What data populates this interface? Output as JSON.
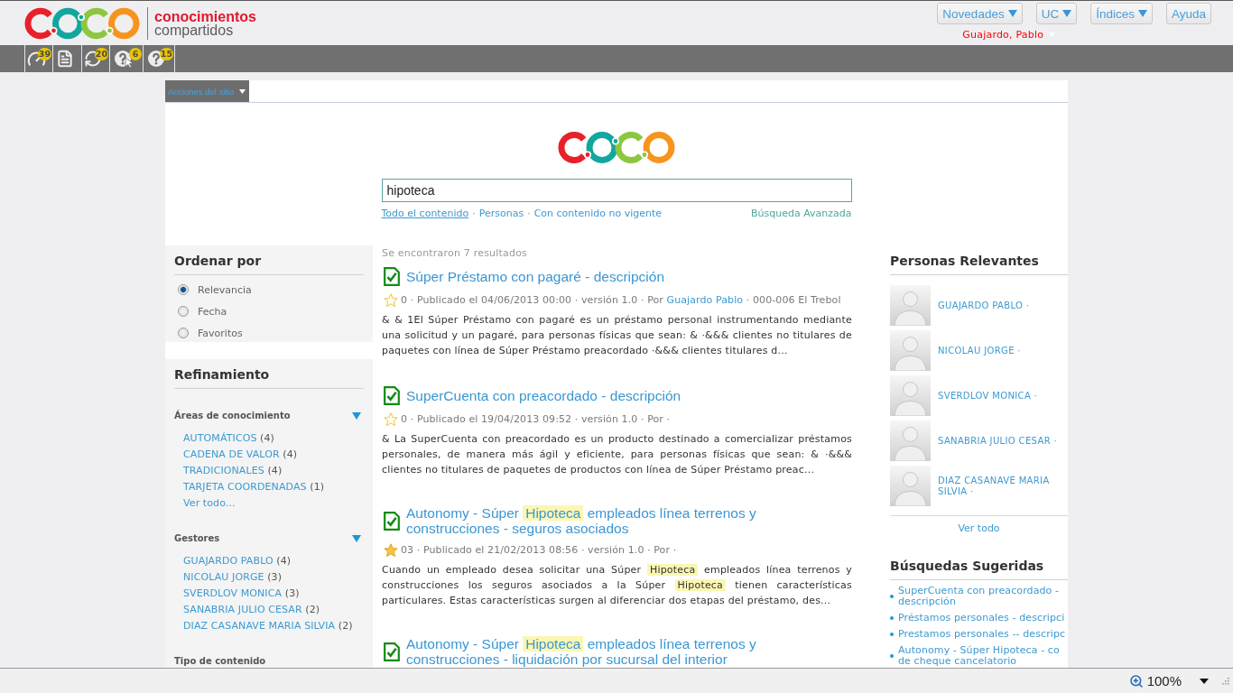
{
  "header": {
    "brand": [
      "conocimientos",
      "compartidos"
    ],
    "menu": [
      {
        "label": "Novedades",
        "dropdown": true
      },
      {
        "label": "UC",
        "dropdown": true
      },
      {
        "label": "Índices",
        "dropdown": true
      },
      {
        "label": "Ayuda",
        "dropdown": false
      }
    ],
    "user": "Guajardo, Pablo"
  },
  "toolbar": [
    {
      "kind": "gauge",
      "badge": "39"
    },
    {
      "kind": "document"
    },
    {
      "kind": "refresh",
      "badge": "20"
    },
    {
      "kind": "help-pointer",
      "badge": "6"
    },
    {
      "kind": "help",
      "badge": "15"
    }
  ],
  "site_actions": "Acciones del sitio",
  "search": {
    "value": "hipoteca",
    "scopes": [
      {
        "label": "Todo el contenido",
        "selected": true
      },
      {
        "label": "Personas",
        "selected": false,
        "separator": "·"
      },
      {
        "label": "Con contenido no vigente",
        "selected": false,
        "separator": "·"
      }
    ],
    "advanced": "Búsqueda Avanzada"
  },
  "sort": {
    "title": "Ordenar por",
    "options": [
      {
        "label": "Relevancia",
        "selected": true
      },
      {
        "label": "Fecha",
        "selected": false
      },
      {
        "label": "Favoritos",
        "selected": false
      }
    ]
  },
  "refinement": {
    "title": "Refinamiento",
    "groups": [
      {
        "title": "Áreas de conocimiento",
        "expanded": true,
        "items": [
          {
            "label": "AUTOMÁTICOS",
            "count": "(4)"
          },
          {
            "label": "CADENA DE VALOR",
            "count": "(4)"
          },
          {
            "label": "TRADICIONALES",
            "count": "(4)"
          },
          {
            "label": "TARJETA COORDENADAS",
            "count": "(1)"
          }
        ],
        "more": "Ver todo..."
      },
      {
        "title": "Gestores",
        "expanded": true,
        "items": [
          {
            "label": "GUAJARDO PABLO",
            "count": "(4)"
          },
          {
            "label": "NICOLAU JORGE",
            "count": "(3)"
          },
          {
            "label": "SVERDLOV MONICA",
            "count": "(3)"
          },
          {
            "label": "SANABRIA JULIO CESAR",
            "count": "(2)"
          },
          {
            "label": "DIAZ CASANAVE MARIA SILVIA",
            "count": "(2)"
          }
        ]
      },
      {
        "title": "Tipo de contenido"
      }
    ]
  },
  "results": {
    "summary": "Se encontraron 7 resultados",
    "items": [
      {
        "title": [
          {
            "kind": "text",
            "text": "Súper Préstamo con pagaré - descripción"
          }
        ],
        "starred": false,
        "meta": [
          {
            "kind": "text",
            "text": "0 · Publicado el 04/06/2013 00:00 · versión 1.0 · Por "
          },
          {
            "kind": "link",
            "text": "Guajardo Pablo"
          },
          {
            "kind": "text",
            "text": " · 000-006 El Trebol"
          }
        ],
        "description": [
          {
            "kind": "text",
            "text": "& & 1El Súper Préstamo con pagaré es un préstamo personal instrumentando mediante una solicitud y un pagaré, para personas físicas que sean: & ·&&& clientes no titulares de paquetes con línea de Súper Préstamo preacordado ·&&& clientes titulares d..."
          }
        ]
      },
      {
        "title": [
          {
            "kind": "text",
            "text": "SuperCuenta con preacordado - descripción"
          }
        ],
        "starred": false,
        "meta": [
          {
            "kind": "text",
            "text": "0 · Publicado el 19/04/2013 09:52 · versión 1.0 · Por ·"
          }
        ],
        "description": [
          {
            "kind": "text",
            "text": "& La SuperCuenta con preacordado es un producto destinado a comercializar préstamos personales, de manera más ágil y eficiente, para personas físicas que sean: & ·&&& clientes no titulares de paquetes de productos con línea de Súper Préstamo preac..."
          }
        ]
      },
      {
        "title": [
          {
            "kind": "text",
            "text": "Autonomy - Súper "
          },
          {
            "kind": "match",
            "text": "Hipoteca"
          },
          {
            "kind": "text",
            "text": " empleados línea terrenos y construcciones - seguros asociados"
          }
        ],
        "starred": true,
        "meta": [
          {
            "kind": "text",
            "text": "03 · Publicado el 21/02/2013 08:56 · versión 1.0 · Por ·"
          }
        ],
        "description": [
          {
            "kind": "text",
            "text": "Cuando un empleado desea solicitar una Súper "
          },
          {
            "kind": "match",
            "text": "Hipoteca"
          },
          {
            "kind": "text",
            "text": " empleados línea terrenos y construcciones los seguros asociados a la Súper "
          },
          {
            "kind": "match",
            "text": "Hipoteca"
          },
          {
            "kind": "text",
            "text": " tienen características particulares. Estas características surgen al diferenciar dos etapas del préstamo, des..."
          }
        ]
      },
      {
        "title": [
          {
            "kind": "text",
            "text": "Autonomy - Súper "
          },
          {
            "kind": "match",
            "text": "Hipoteca"
          },
          {
            "kind": "text",
            "text": " empleados línea terrenos y construcciones - liquidación por sucursal del interior"
          }
        ]
      }
    ]
  },
  "people": {
    "title": "Personas Relevantes",
    "items": [
      "GUAJARDO PABLO ·",
      "NICOLAU JORGE ·",
      "SVERDLOV MONICA ·",
      "SANABRIA JULIO CESAR ·",
      "DIAZ CASANAVE MARIA SILVIA ·"
    ],
    "more": "Ver todo"
  },
  "suggestions": {
    "title": "Búsquedas Sugeridas",
    "items": [
      {
        "lines": [
          "SuperCuenta con preacordado -",
          "descripción"
        ]
      },
      {
        "lines": [
          "Préstamos personales - descripci"
        ]
      },
      {
        "lines": [
          "Prestamos personales -- descripc"
        ]
      },
      {
        "lines": [
          "Autonomy - Súper Hipoteca - co",
          "de cheque cancelatorio"
        ]
      }
    ]
  },
  "status_bar": {
    "zoom": "100%"
  }
}
